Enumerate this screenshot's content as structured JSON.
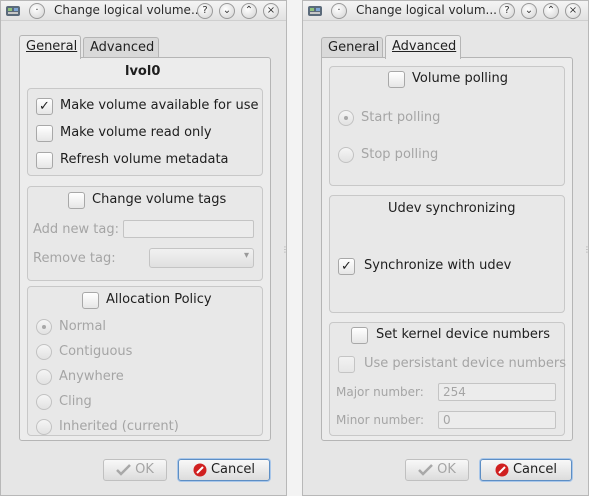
{
  "left": {
    "title": "Change logical volume...",
    "tabs": [
      "General",
      "Advanced"
    ],
    "volume_name": "lvol0",
    "options": [
      {
        "label": "Make volume available for use",
        "checked": true
      },
      {
        "label": "Make volume read only",
        "checked": false
      },
      {
        "label": "Refresh volume metadata",
        "checked": false
      }
    ],
    "tags": {
      "title": "Change volume tags",
      "add_label": "Add new tag:",
      "remove_label": "Remove tag:"
    },
    "policy": {
      "title": "Allocation Policy",
      "options": [
        "Normal",
        "Contiguous",
        "Anywhere",
        "Cling",
        "Inherited (current)"
      ],
      "selected": "Normal"
    },
    "ok_label": "OK",
    "cancel_label": "Cancel"
  },
  "right": {
    "title": "Change logical volum...",
    "tabs": [
      "General",
      "Advanced"
    ],
    "polling": {
      "title": "Volume polling",
      "start": "Start polling",
      "stop": "Stop polling"
    },
    "udev": {
      "title": "Udev synchronizing",
      "sync_label": "Synchronize with udev",
      "sync_checked": true
    },
    "kernel": {
      "title": "Set kernel device numbers",
      "persistent": "Use persistant device numbers",
      "major_label": "Major number:",
      "major_value": "254",
      "minor_label": "Minor number:",
      "minor_value": "0"
    },
    "ok_label": "OK",
    "cancel_label": "Cancel"
  },
  "colors": {
    "window_bg": "#e6e6e6",
    "disabled_text": "#a5a5a5",
    "focus_border": "#5d8ec4",
    "cancel_icon": "#d02020",
    "ok_icon": "#a8a8a8"
  },
  "icons": [
    "app-icon",
    "help-icon",
    "minimize-icon",
    "maximize-icon",
    "close-icon",
    "check-icon",
    "cancel-icon"
  ]
}
